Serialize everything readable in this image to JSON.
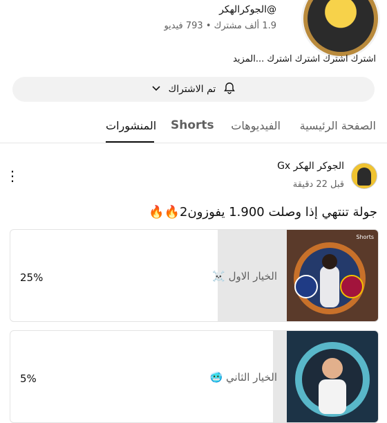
{
  "channel": {
    "handle": "@الجوكرالهكر",
    "stats": "1.9 ألف مشترك • 793 فيديو",
    "description": "اشترك اشترك اشترك اشترك ...المزيد",
    "subscribe_label": "تم الاشتراك"
  },
  "tabs": {
    "home": "الصفحة الرئيسية",
    "videos": "الفيديوهات",
    "shorts": "Shorts",
    "posts": "المنشورات"
  },
  "post": {
    "author": "الجوكر الهكر Gx",
    "time": "قبل 22 دقيقة",
    "text": "جولة تنتهي إذا وصلت 1.900 يفوزون2🔥🔥",
    "poll": [
      {
        "label": "الخيار الاول ☠️",
        "percent": "25%",
        "value": 0.25
      },
      {
        "label": "الخيار الثاني 🥶",
        "percent": "5%",
        "value": 0.05
      }
    ],
    "thumb_tag": "Shorts"
  }
}
